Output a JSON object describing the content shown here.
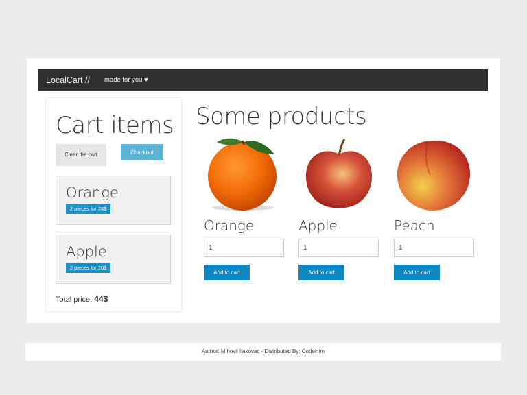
{
  "navbar": {
    "brand": "LocalCart //",
    "tagline": "made for you ♥"
  },
  "cart": {
    "title": "Cart items",
    "clear_label": "Clear the cart",
    "checkout_label": "Checkout",
    "items": [
      {
        "name": "Orange",
        "badge": "2 pieces for 24$"
      },
      {
        "name": "Apple",
        "badge": "2 pieces for 20$"
      }
    ],
    "total_label": "Total price:",
    "total_value": "44$"
  },
  "products": {
    "title": "Some products",
    "items": [
      {
        "name": "Orange",
        "qty": "1",
        "add_label": "Add to cart",
        "image_icon": "orange-fruit"
      },
      {
        "name": "Apple",
        "qty": "1",
        "add_label": "Add to cart",
        "image_icon": "apple-fruit"
      },
      {
        "name": "Peach",
        "qty": "1",
        "add_label": "Add to cart",
        "image_icon": "peach-fruit"
      }
    ]
  },
  "footer": {
    "text": "Author: Mihovil Ilakovac - Distributed By: CodeHim"
  },
  "colors": {
    "navbar": "#2f2f2f",
    "primary_button": "#0f87c1",
    "checkout_button": "#5bb3d6",
    "badge": "#1f8fc4"
  }
}
